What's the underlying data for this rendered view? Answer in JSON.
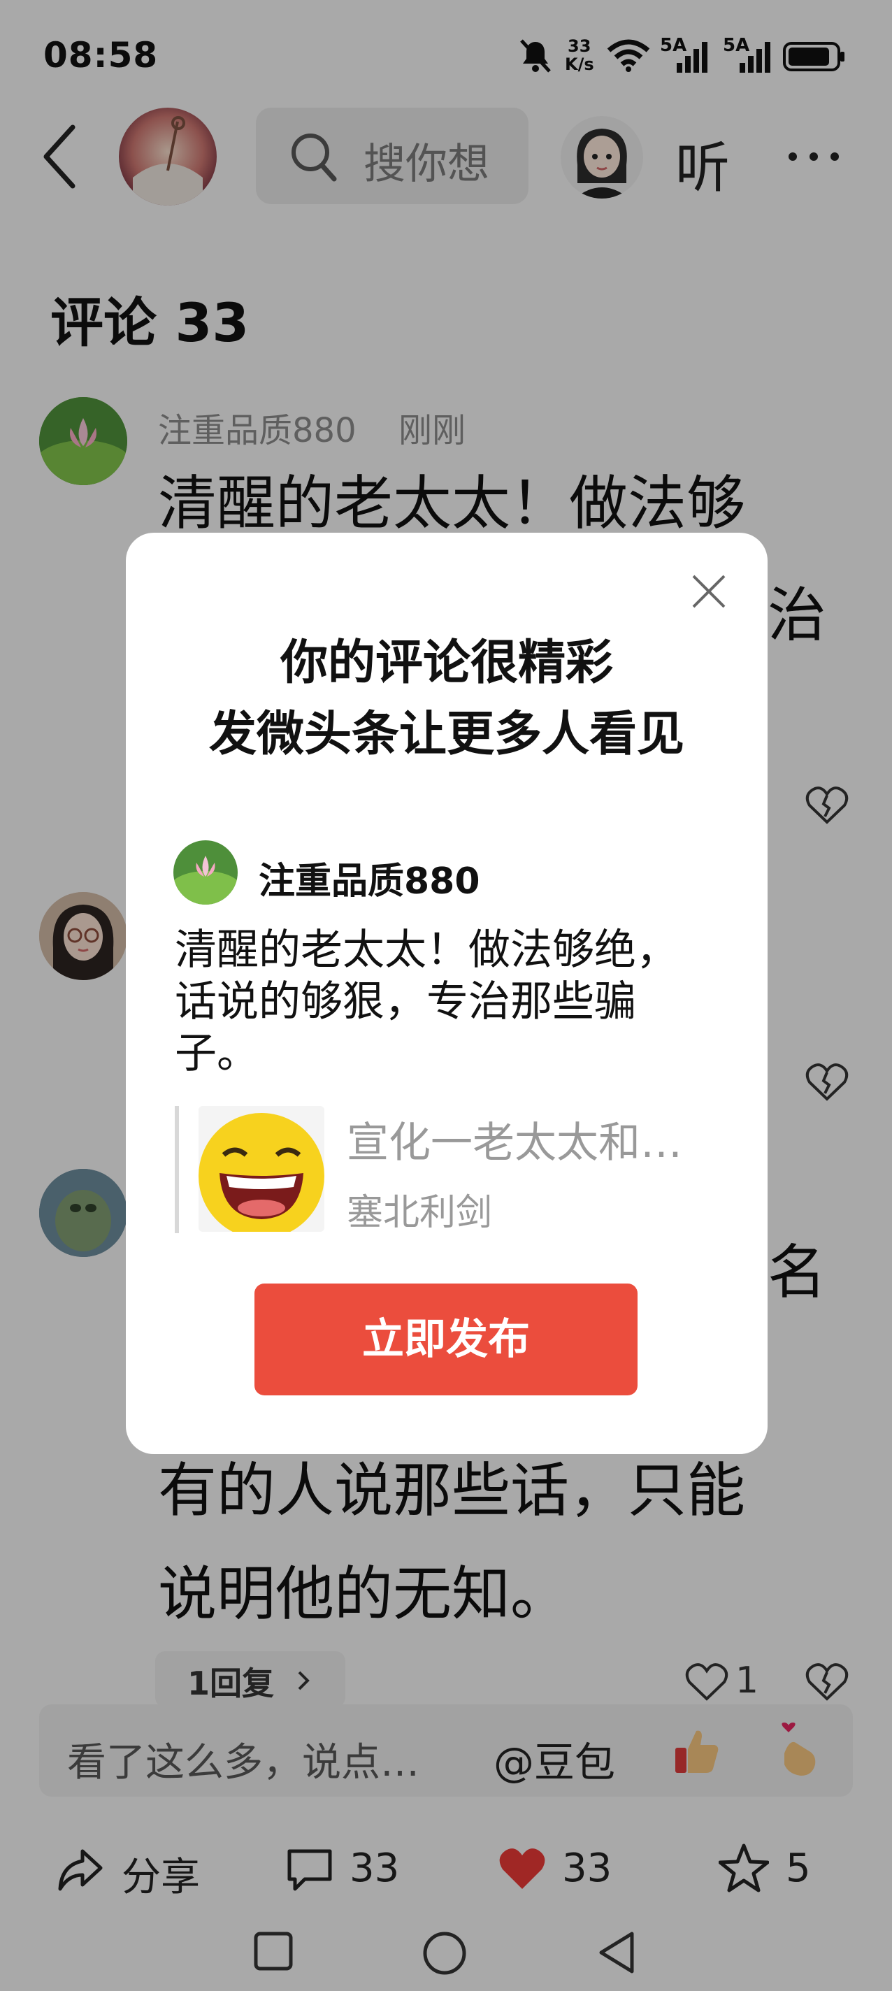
{
  "status_bar": {
    "time": "08:58",
    "net_speed_top": "33",
    "net_speed_bottom": "K/s",
    "sim1": "5A",
    "sim2": "5A",
    "icons": [
      "mute-bell-icon",
      "wifi-icon",
      "signal-icon",
      "signal-icon",
      "battery-icon"
    ]
  },
  "top_bar": {
    "search_placeholder": "搜你想",
    "listen_label": "听"
  },
  "comments": {
    "title": "评论 33",
    "items": [
      {
        "user": "注重品质880",
        "time": "刚刚",
        "text_line1": "清醒的老太太！做法够",
        "text_line2_tail": "治"
      },
      {
        "text_fragment": "名"
      },
      {
        "text_line1": "有的人说那些话，只能",
        "text_line2": "说明他的无知。",
        "reply_label": "1回复",
        "like_count": "1"
      }
    ]
  },
  "input_bar": {
    "placeholder": "看了这么多，说点…",
    "mention": "@豆包"
  },
  "actions": {
    "share_label": "分享",
    "comment_count": "33",
    "like_count": "33",
    "favorite_count": "5"
  },
  "modal": {
    "title_line1": "你的评论很精彩",
    "title_line2": "发微头条让更多人看见",
    "user": "注重品质880",
    "body": "清醒的老太太！做法够绝，话说的够狠，专治那些骗子。",
    "quote_title": "宣化一老太太和…",
    "quote_source": "塞北利剑",
    "publish_label": "立即发布"
  },
  "colors": {
    "accent_red": "#eb4d3d",
    "like_red": "#e53935"
  }
}
